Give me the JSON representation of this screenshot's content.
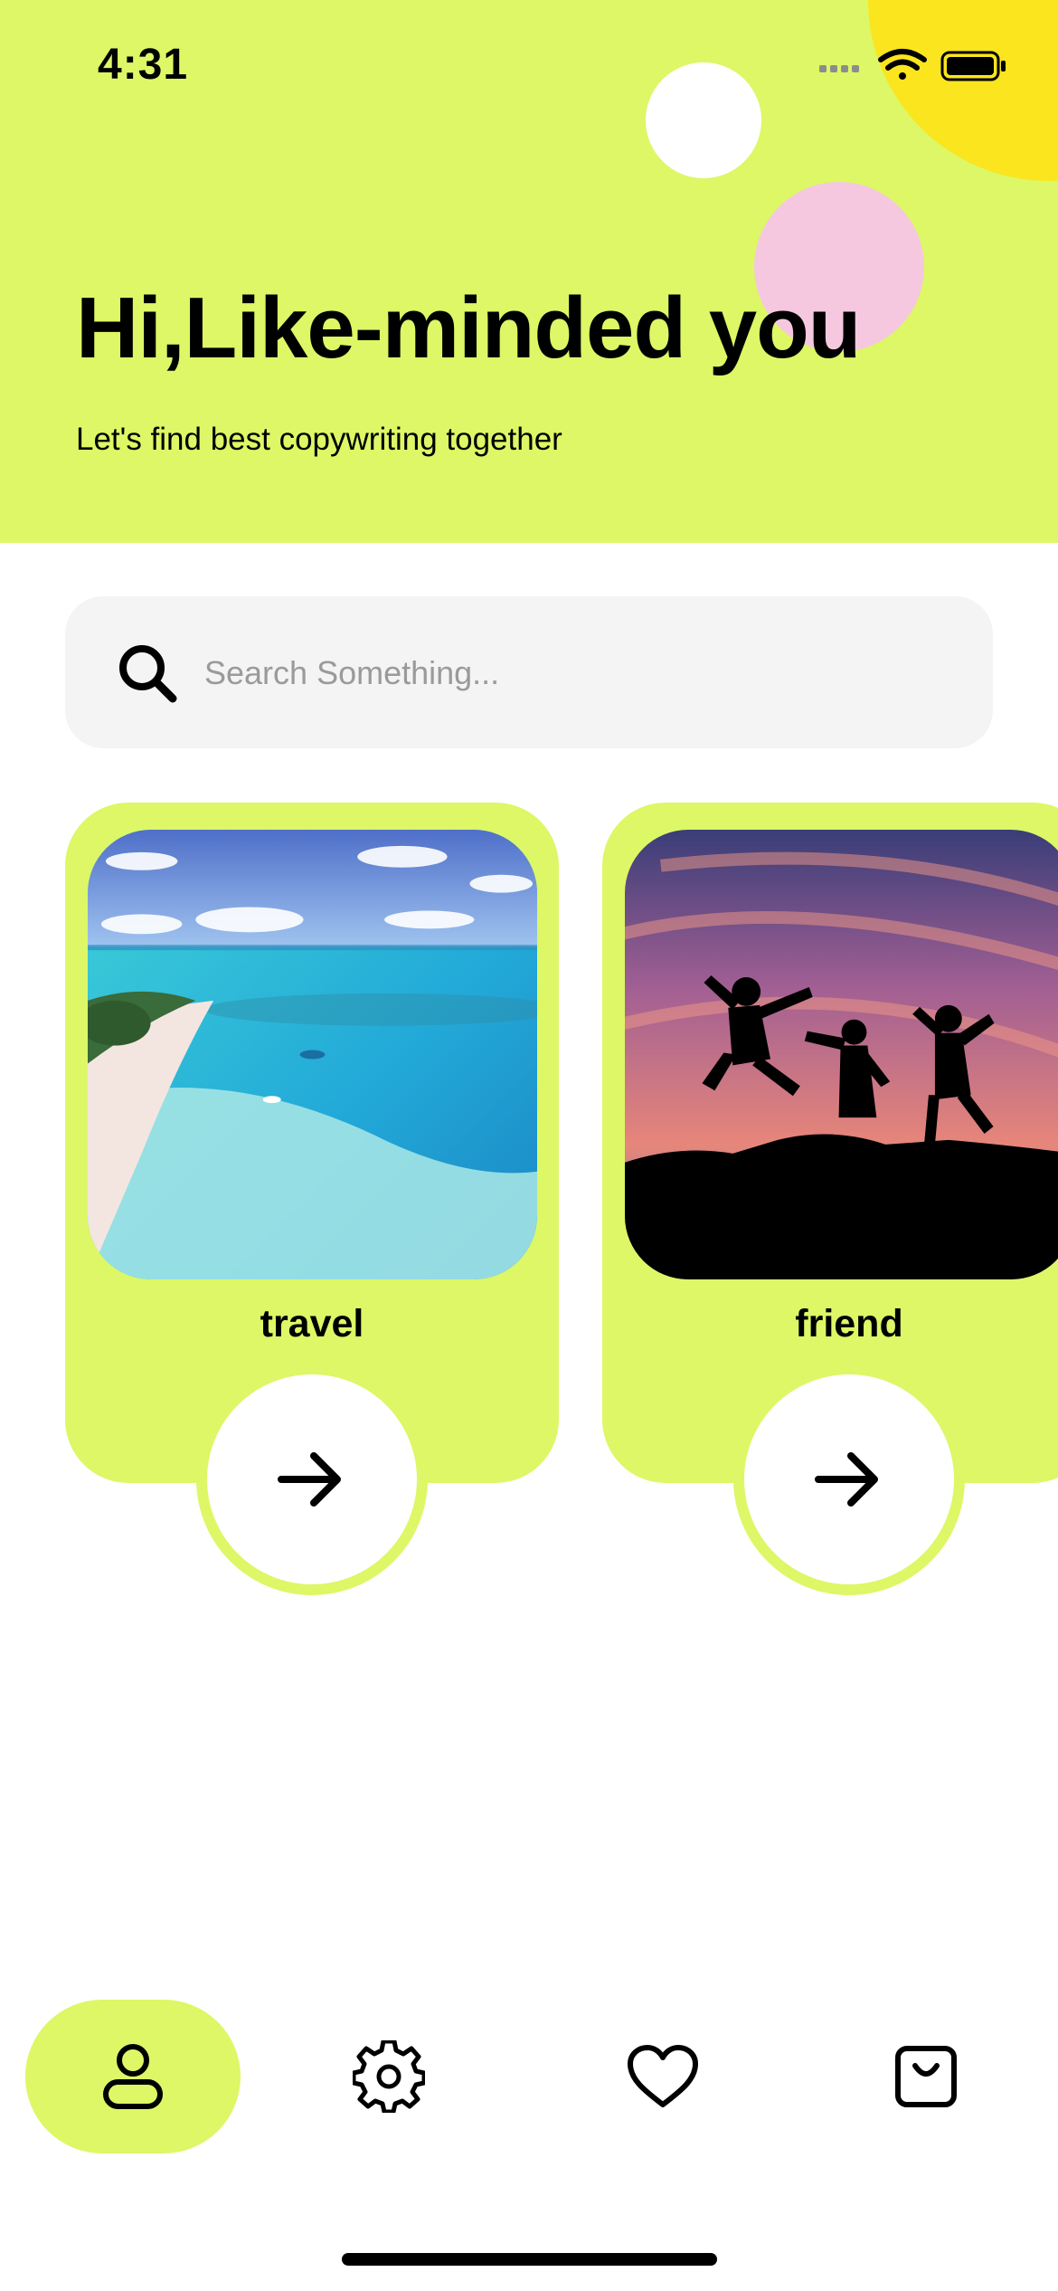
{
  "status_bar": {
    "time": "4:31",
    "icons": [
      "cellular-signal-icon",
      "wifi-icon",
      "battery-icon"
    ]
  },
  "header": {
    "title": "Hi,Like-minded you",
    "subtitle": "Let's find best copywriting together"
  },
  "search": {
    "placeholder": "Search Something...",
    "value": "",
    "icon": "search-icon"
  },
  "categories": [
    {
      "label": "travel",
      "image": "tropical-beach-aerial-photo",
      "action_icon": "arrow-right-icon"
    },
    {
      "label": "friend",
      "image": "friends-jumping-sunset-silhouette-photo",
      "action_icon": "arrow-right-icon"
    }
  ],
  "bottom_nav": {
    "items": [
      {
        "name": "profile",
        "icon": "user-icon",
        "active": true
      },
      {
        "name": "settings",
        "icon": "gear-icon",
        "active": false
      },
      {
        "name": "favorites",
        "icon": "heart-icon",
        "active": false
      },
      {
        "name": "bag",
        "icon": "shopping-bag-icon",
        "active": false
      }
    ]
  },
  "colors": {
    "accent_lime": "#ddf766",
    "yellow": "#fae51e",
    "pink": "#f5c8e0",
    "search_bg": "#f4f4f4",
    "text": "#000000"
  }
}
